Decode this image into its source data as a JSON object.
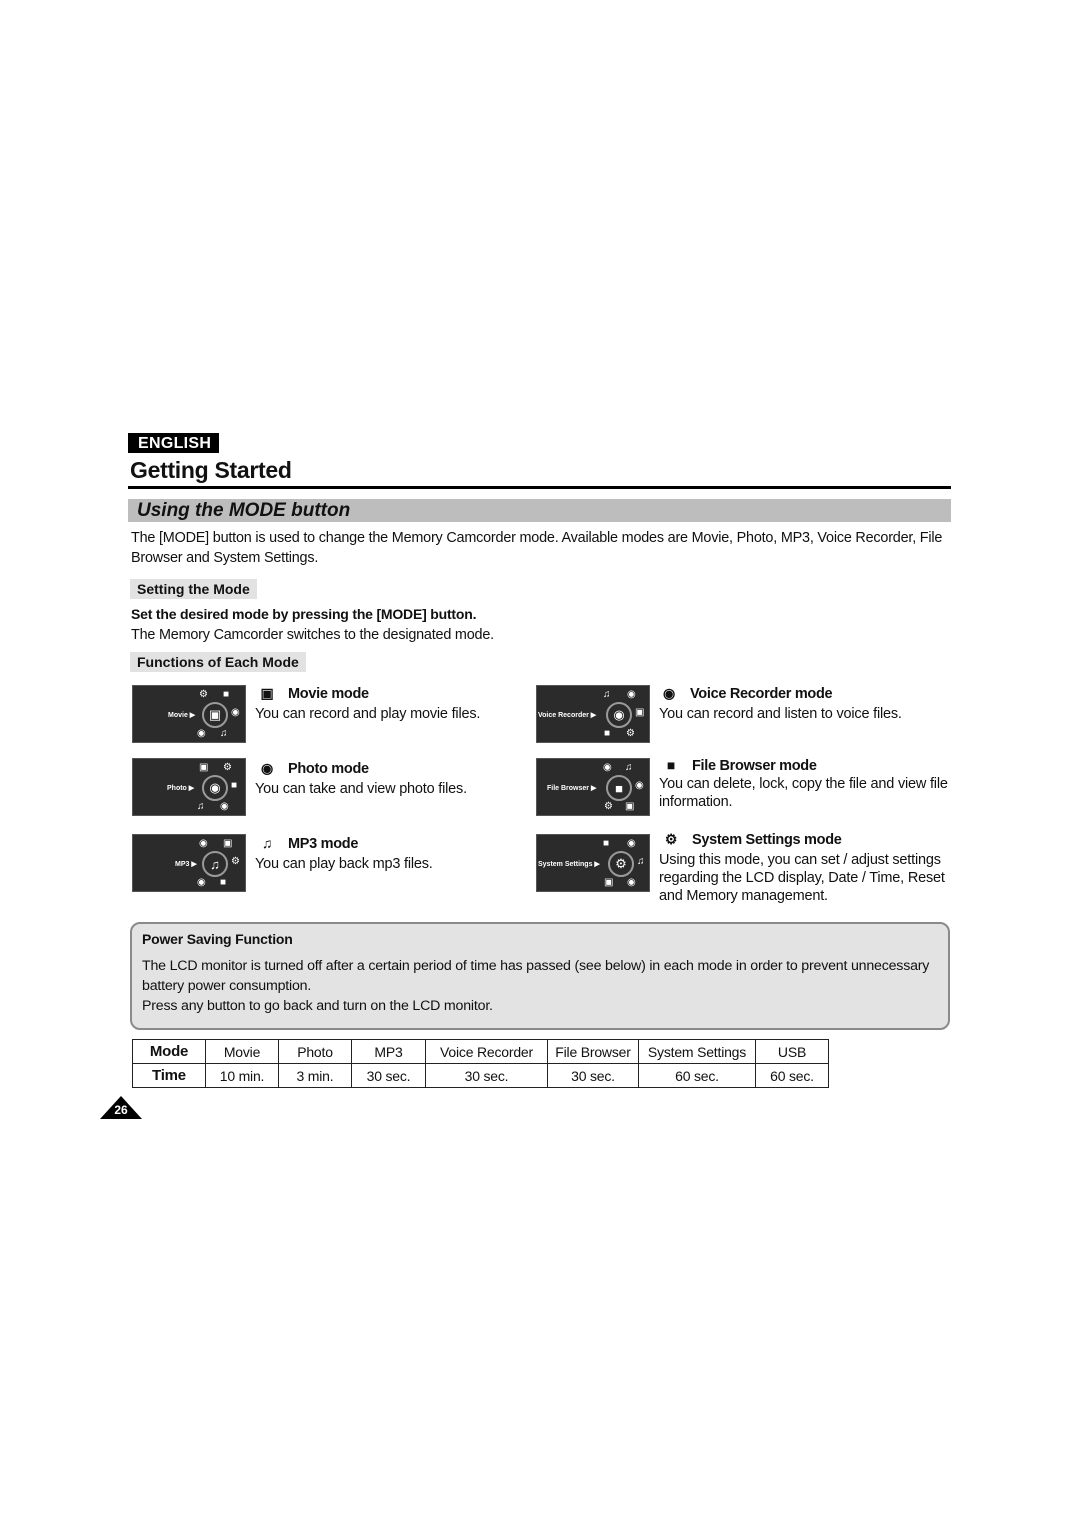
{
  "header": {
    "language_badge": "ENGLISH",
    "chapter_title": "Getting Started",
    "section_title": "Using the MODE button"
  },
  "intro": "The [MODE] button is used to change the Memory Camcorder mode. Available modes are Movie, Photo, MP3, Voice Recorder, File Browser and System Settings.",
  "setting_mode": {
    "tag": "Setting the Mode",
    "instruction": "Set the desired mode by pressing the [MODE] button.",
    "result": "The Memory Camcorder switches to the designated mode."
  },
  "functions": {
    "tag": "Functions of Each Mode",
    "modes": [
      {
        "lcd_label": "Movie ▶",
        "icon": "movie-camera",
        "title": "Movie mode",
        "desc": "You can record and play movie files."
      },
      {
        "lcd_label": "Photo ▶",
        "icon": "camera",
        "title": "Photo mode",
        "desc": "You can take and view photo files."
      },
      {
        "lcd_label": "MP3 ▶",
        "icon": "music-note",
        "title": "MP3 mode",
        "desc": "You can play back mp3 files."
      },
      {
        "lcd_label": "Voice Recorder ▶",
        "icon": "microphone",
        "title": "Voice Recorder mode",
        "desc": "You can record and listen to voice files."
      },
      {
        "lcd_label": "File Browser ▶",
        "icon": "folder",
        "title": "File Browser mode",
        "desc": "You can delete, lock, copy the file and view file information."
      },
      {
        "lcd_label": "System Settings ▶",
        "icon": "gear",
        "title": "System Settings mode",
        "desc": "Using this mode, you can set / adjust settings regarding the LCD display, Date / Time, Reset and Memory management."
      }
    ]
  },
  "power_saving": {
    "title": "Power Saving Function",
    "text1": "The LCD monitor is turned off after a certain period of time has passed (see below) in each mode in order to prevent unnecessary battery power consumption.",
    "text2": "Press any button to go back and turn on the LCD monitor."
  },
  "timeout_table": {
    "row_headers": [
      "Mode",
      "Time"
    ],
    "columns": [
      {
        "mode": "Movie",
        "time": "10 min."
      },
      {
        "mode": "Photo",
        "time": "3 min."
      },
      {
        "mode": "MP3",
        "time": "30 sec."
      },
      {
        "mode": "Voice Recorder",
        "time": "30 sec."
      },
      {
        "mode": "File Browser",
        "time": "30 sec."
      },
      {
        "mode": "System Settings",
        "time": "60 sec."
      },
      {
        "mode": "USB",
        "time": "60 sec."
      }
    ]
  },
  "page_number": "26"
}
